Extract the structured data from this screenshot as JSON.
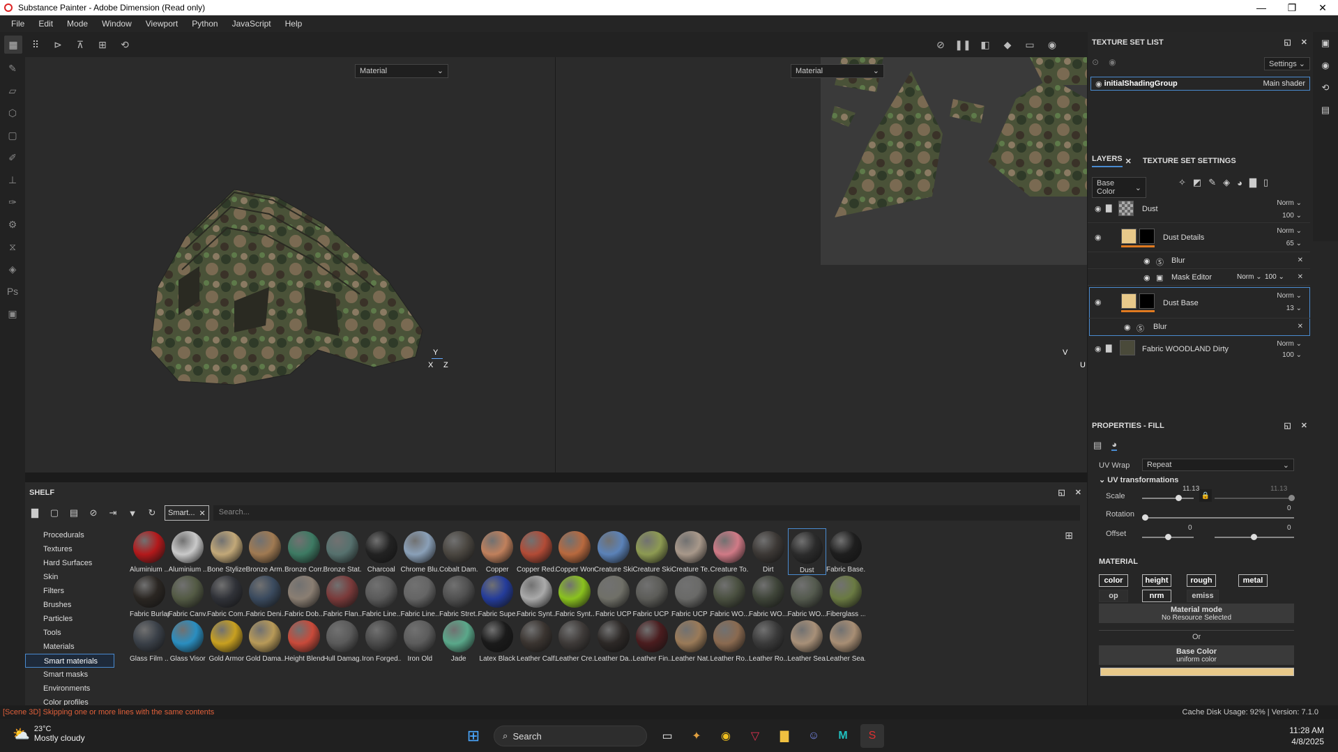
{
  "window": {
    "title": "Substance Painter - Adobe Dimension (Read only)",
    "min": "—",
    "max": "❐",
    "close": "✕"
  },
  "menu": [
    "File",
    "Edit",
    "Mode",
    "Window",
    "Viewport",
    "Python",
    "JavaScript",
    "Help"
  ],
  "viewport": {
    "left_select": "Material",
    "right_select": "Material",
    "axis_y": "Y",
    "axis_x": "X",
    "axis_z": "Z",
    "uv_v": "V",
    "uv_u": "U"
  },
  "shelf": {
    "title": "SHELF",
    "filter_tag": "Smart...",
    "search_placeholder": "Search...",
    "categories": [
      "Procedurals",
      "Textures",
      "Hard Surfaces",
      "Skin",
      "Filters",
      "Brushes",
      "Particles",
      "Tools",
      "Materials",
      "Smart materials",
      "Smart masks",
      "Environments",
      "Color profiles"
    ],
    "selected_category": "Smart materials",
    "materials": [
      {
        "label": "Aluminium ...",
        "color": "#b3191b"
      },
      {
        "label": "Aluminium ...",
        "color": "#c9c9c9"
      },
      {
        "label": "Bone Stylized",
        "color": "#c2a878"
      },
      {
        "label": "Bronze Arm...",
        "color": "#a07a52"
      },
      {
        "label": "Bronze Corr...",
        "color": "#3d7a63"
      },
      {
        "label": "Bronze Stat...",
        "color": "#56716e"
      },
      {
        "label": "Charcoal",
        "color": "#222222"
      },
      {
        "label": "Chrome Blu...",
        "color": "#8aa0b8"
      },
      {
        "label": "Cobalt Dam...",
        "color": "#4a4640"
      },
      {
        "label": "Copper",
        "color": "#c0805c"
      },
      {
        "label": "Copper Red...",
        "color": "#b24b36"
      },
      {
        "label": "Copper Worn",
        "color": "#b8693e"
      },
      {
        "label": "Creature Ski...",
        "color": "#5b82b8"
      },
      {
        "label": "Creature Ski...",
        "color": "#8d9a52"
      },
      {
        "label": "Creature Te...",
        "color": "#a8988a"
      },
      {
        "label": "Creature To...",
        "color": "#d07a86"
      },
      {
        "label": "Dirt",
        "color": "#3c3835"
      },
      {
        "label": "Dust",
        "color": "#2b2b2b"
      },
      {
        "label": "Fabric Base...",
        "color": "#1e1e1e"
      },
      {
        "label": "Fabric Burlap",
        "color": "#2a2622"
      },
      {
        "label": "Fabric Canv...",
        "color": "#535a44"
      },
      {
        "label": "Fabric Com...",
        "color": "#303238"
      },
      {
        "label": "Fabric Deni...",
        "color": "#3a4a5e"
      },
      {
        "label": "Fabric Dob...",
        "color": "#8a7e72"
      },
      {
        "label": "Fabric Flan...",
        "color": "#7a3a3a"
      },
      {
        "label": "Fabric Line...",
        "color": "#5a5a5a"
      },
      {
        "label": "Fabric Line...",
        "color": "#656565"
      },
      {
        "label": "Fabric Stret...",
        "color": "#505050"
      },
      {
        "label": "Fabric Supe...",
        "color": "#243c9a"
      },
      {
        "label": "Fabric Synt...",
        "color": "#aaaaaa"
      },
      {
        "label": "Fabric Synt...",
        "color": "#8ac21e"
      },
      {
        "label": "Fabric UCP",
        "color": "#707068"
      },
      {
        "label": "Fabric UCP ...",
        "color": "#5c5c58"
      },
      {
        "label": "Fabric UCP ...",
        "color": "#6a6a68"
      },
      {
        "label": "Fabric WO...",
        "color": "#4a5040"
      },
      {
        "label": "Fabric WO...",
        "color": "#3e4438"
      },
      {
        "label": "Fabric WO...",
        "color": "#545a4e"
      },
      {
        "label": "Fiberglass ...",
        "color": "#6a7a42"
      },
      {
        "label": "Glass Film ...",
        "color": "#3a4048"
      },
      {
        "label": "Glass Visor",
        "color": "#2a8ec0"
      },
      {
        "label": "Gold Armor",
        "color": "#c8a020"
      },
      {
        "label": "Gold Dama...",
        "color": "#b89a58"
      },
      {
        "label": "Height Blend",
        "color": "#c84a3a"
      },
      {
        "label": "Hull Damag...",
        "color": "#5a5a5a"
      },
      {
        "label": "Iron Forged...",
        "color": "#4a4a4a"
      },
      {
        "label": "Iron Old",
        "color": "#5c5c5c"
      },
      {
        "label": "Jade",
        "color": "#5aa88a"
      },
      {
        "label": "Latex Black",
        "color": "#1a1a1a"
      },
      {
        "label": "Leather Calf...",
        "color": "#3a3430"
      },
      {
        "label": "Leather Cre...",
        "color": "#3e3a38"
      },
      {
        "label": "Leather Da...",
        "color": "#2c2826"
      },
      {
        "label": "Leather Fin...",
        "color": "#4a1c1e"
      },
      {
        "label": "Leather Nat...",
        "color": "#9a7a58"
      },
      {
        "label": "Leather Ro...",
        "color": "#8a6a50"
      },
      {
        "label": "Leather Ro...",
        "color": "#3a3a3a"
      },
      {
        "label": "Leather Sea...",
        "color": "#a89078"
      },
      {
        "label": "Leather Sea...",
        "color": "#a88e74"
      }
    ]
  },
  "texture_set_list": {
    "title": "TEXTURE SET LIST",
    "settings": "Settings",
    "item_name": "initialShadingGroup",
    "item_shader": "Main shader"
  },
  "layers_panel": {
    "tab_layers": "LAYERS",
    "tab_settings": "TEXTURE SET SETTINGS",
    "channel": "Base Color",
    "layers": [
      {
        "name": "Dust",
        "blend": "Norm",
        "opacity": "100"
      },
      {
        "name": "Dust Details",
        "blend": "Norm",
        "opacity": "65"
      },
      {
        "name": "Blur"
      },
      {
        "name": "Mask Editor",
        "blend": "Norm",
        "opacity": "100"
      },
      {
        "name": "Dust Base",
        "blend": "Norm",
        "opacity": "13"
      },
      {
        "name": "Blur"
      },
      {
        "name": "Fabric WOODLAND Dirty",
        "blend": "Norm",
        "opacity": "100"
      }
    ]
  },
  "properties": {
    "title": "PROPERTIES - FILL",
    "uv_wrap_label": "UV Wrap",
    "uv_wrap_value": "Repeat",
    "uv_transformations": "UV transformations",
    "scale_label": "Scale",
    "scale_value": "11.13",
    "scale_value2": "11.13",
    "rotation_label": "Rotation",
    "rotation_value": "0",
    "offset_label": "Offset",
    "offset_x": "0",
    "offset_y": "0",
    "material_title": "MATERIAL",
    "channels": [
      "color",
      "height",
      "rough",
      "metal",
      "op",
      "nrm",
      "emiss"
    ],
    "material_mode": "Material mode",
    "no_resource": "No Resource Selected",
    "or": "Or",
    "base_color": "Base Color",
    "uniform_color": "uniform color",
    "base_color_swatch": "#e8c98a"
  },
  "status": {
    "message": "[Scene 3D] Skipping one or more lines with the same contents",
    "cache": "Cache Disk Usage:   92% | Version: 7.1.0"
  },
  "taskbar": {
    "temp": "23°C",
    "weather": "Mostly cloudy",
    "search": "Search",
    "time": "11:28 AM",
    "date": "4/8/2025"
  }
}
